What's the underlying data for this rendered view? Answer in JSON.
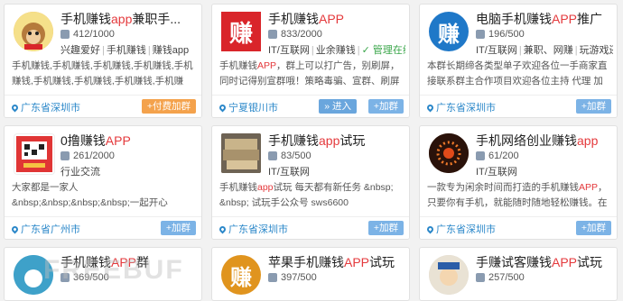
{
  "cards": [
    {
      "title_pre": "手机赚钱",
      "title_hl": "app",
      "title_post": "兼职手...",
      "members": "412/1000",
      "tags": [
        "兴趣爱好",
        "手机赚钱",
        "赚钱app"
      ],
      "desc": "手机赚钱,手机赚钱,手机赚钱,手机赚钱,手机赚钱,手机赚钱,手机赚钱,手机赚钱,手机赚钱,手机赚钱,手机赚钱",
      "location": "广东省深圳市",
      "buttons": [
        "+付费加群"
      ],
      "avatar_text": "",
      "avatar_color": "#f2b33d"
    },
    {
      "title_pre": "手机赚钱",
      "title_hl": "APP",
      "title_post": "",
      "members": "833/2000",
      "tags": [
        "IT/互联网",
        "业余赚钱",
        "✓ 管理在线"
      ],
      "desc_pre": "手机赚钱",
      "desc_hl": "APP",
      "desc_post": "，群上可以打广告，别刷屏，同时记得别宣群哦！策略毒骗、宣群、刷屏的一律做移...",
      "location": "宁夏银川市",
      "buttons": [
        "» 进入",
        "+加群"
      ],
      "avatar_text": "赚",
      "avatar_color": "#d9252a"
    },
    {
      "title_pre": "电脑手机赚钱",
      "title_hl": "APP",
      "title_post": "推广",
      "members": "196/500",
      "tags": [
        "IT/互联网",
        "兼职、网赚",
        "玩游戏还..."
      ],
      "desc": "本群长期缔各类型单子欢迎各位一手商家直接联系群主合作项目欢迎各位主持 代理 加入接单信誉...",
      "location": "广东省深圳市",
      "buttons": [
        "+加群"
      ],
      "avatar_text": "赚",
      "avatar_color": "#1f78c8"
    },
    {
      "title_pre": "0撸赚钱",
      "title_hl": "APP",
      "title_post": "",
      "members": "261/2000",
      "tags": [
        "行业交流"
      ],
      "desc": "大家都是一家人&nbsp;&nbsp;&nbsp;&nbsp;一起开心&nbsp;&nbsp;&nbsp;一起赚钱",
      "location": "广东省广州市",
      "buttons": [
        "+加群"
      ],
      "avatar_text": "",
      "avatar_color": "#e03535"
    },
    {
      "title_pre": "手机赚钱",
      "title_hl": "app",
      "title_post": "试玩",
      "members": "83/500",
      "tags": [
        "IT/互联网"
      ],
      "desc_pre": "手机赚钱",
      "desc_hl": "app",
      "desc_post": "试玩 每天都有新任务 &nbsp; &nbsp; 试玩手公众号 sws6600",
      "location": "广东省深圳市",
      "buttons": [
        "+加群"
      ],
      "avatar_text": "",
      "avatar_color": "#8a7a63"
    },
    {
      "title_pre": "手机网络创业赚钱",
      "title_hl": "app",
      "title_post": "",
      "members": "61/200",
      "tags": [
        "IT/互联网"
      ],
      "desc_pre": "一款专为闲余时间而打造的手机赚钱",
      "desc_hl": "APP",
      "desc_post": "，只要你有手机，就能随时随地轻松赚钱。在手机上，通...",
      "location": "广东省深圳市",
      "buttons": [
        "+加群"
      ],
      "avatar_text": "",
      "avatar_color": "#3a1a0c"
    },
    {
      "title_pre": "手机赚钱",
      "title_hl": "APP",
      "title_post": "群",
      "members": "369/500",
      "avatar_text": "",
      "avatar_color": "#3ea1c9"
    },
    {
      "title_pre": "苹果手机赚钱",
      "title_hl": "APP",
      "title_post": "试玩",
      "members": "397/500",
      "avatar_text": "赚",
      "avatar_color": "#e0941e"
    },
    {
      "title_pre": "手赚试客赚钱",
      "title_hl": "APP",
      "title_post": "试玩",
      "members": "257/500",
      "avatar_text": "",
      "avatar_color": "#d9d2c4"
    }
  ],
  "watermark": "FREEBUF"
}
